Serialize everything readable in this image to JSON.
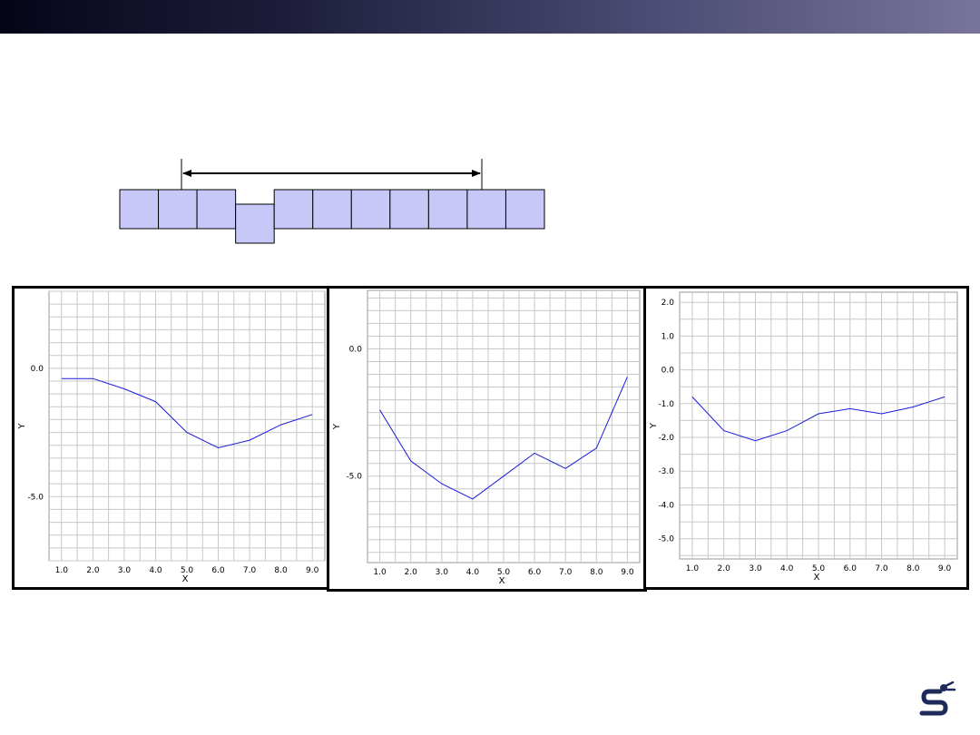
{
  "colors": {
    "header_gradient": [
      "#050519",
      "#78749a"
    ],
    "cell_fill": "#c8c8f8",
    "series_line": "#1a1adc",
    "logo": "#1e2a5a"
  },
  "diagram": {
    "cell_count": 11,
    "offset_cell_index": 3
  },
  "chart_data": [
    {
      "type": "line",
      "xlabel": "X",
      "ylabel": "Y",
      "xlim": [
        0.6,
        9.4
      ],
      "ylim": [
        -7.5,
        3.0
      ],
      "x_ticks": [
        "1.0",
        "2.0",
        "3.0",
        "4.0",
        "5.0",
        "6.0",
        "7.0",
        "8.0",
        "9.0"
      ],
      "y_ticks": [
        {
          "value": 0.0,
          "label": "0.0"
        },
        {
          "value": -5.0,
          "label": "-5.0"
        }
      ],
      "grid": true,
      "series": [
        {
          "x": [
            1,
            2,
            3,
            4,
            5,
            6,
            7,
            8,
            9
          ],
          "y": [
            -0.4,
            -0.4,
            -0.8,
            -1.3,
            -2.5,
            -3.1,
            -2.8,
            -2.2,
            -1.8
          ]
        }
      ]
    },
    {
      "type": "line",
      "xlabel": "X",
      "ylabel": "Y",
      "xlim": [
        0.6,
        9.4
      ],
      "ylim": [
        -8.4,
        2.3
      ],
      "x_ticks": [
        "1.0",
        "2.0",
        "3.0",
        "4.0",
        "5.0",
        "6.0",
        "7.0",
        "8.0",
        "9.0"
      ],
      "y_ticks": [
        {
          "value": 0.0,
          "label": "0.0"
        },
        {
          "value": -5.0,
          "label": "-5.0"
        }
      ],
      "grid": true,
      "series": [
        {
          "x": [
            1,
            2,
            3,
            4,
            5,
            6,
            7,
            8,
            9
          ],
          "y": [
            -2.4,
            -4.4,
            -5.3,
            -5.9,
            -5.0,
            -4.1,
            -4.7,
            -3.9,
            -1.1
          ]
        }
      ]
    },
    {
      "type": "line",
      "xlabel": "X",
      "ylabel": "Y",
      "xlim": [
        0.6,
        9.4
      ],
      "ylim": [
        -5.6,
        2.3
      ],
      "x_ticks": [
        "1.0",
        "2.0",
        "3.0",
        "4.0",
        "5.0",
        "6.0",
        "7.0",
        "8.0",
        "9.0"
      ],
      "y_ticks": [
        {
          "value": 2.0,
          "label": "2.0"
        },
        {
          "value": 1.0,
          "label": "1.0"
        },
        {
          "value": 0.0,
          "label": "0.0"
        },
        {
          "value": -1.0,
          "label": "-1.0"
        },
        {
          "value": -2.0,
          "label": "-2.0"
        },
        {
          "value": -3.0,
          "label": "-3.0"
        },
        {
          "value": -4.0,
          "label": "-4.0"
        },
        {
          "value": -5.0,
          "label": "-5.0"
        }
      ],
      "grid": true,
      "series": [
        {
          "x": [
            1,
            2,
            3,
            4,
            5,
            6,
            7,
            8,
            9
          ],
          "y": [
            -0.8,
            -1.8,
            -2.1,
            -1.8,
            -1.3,
            -1.15,
            -1.3,
            -1.1,
            -0.8
          ]
        }
      ]
    }
  ]
}
